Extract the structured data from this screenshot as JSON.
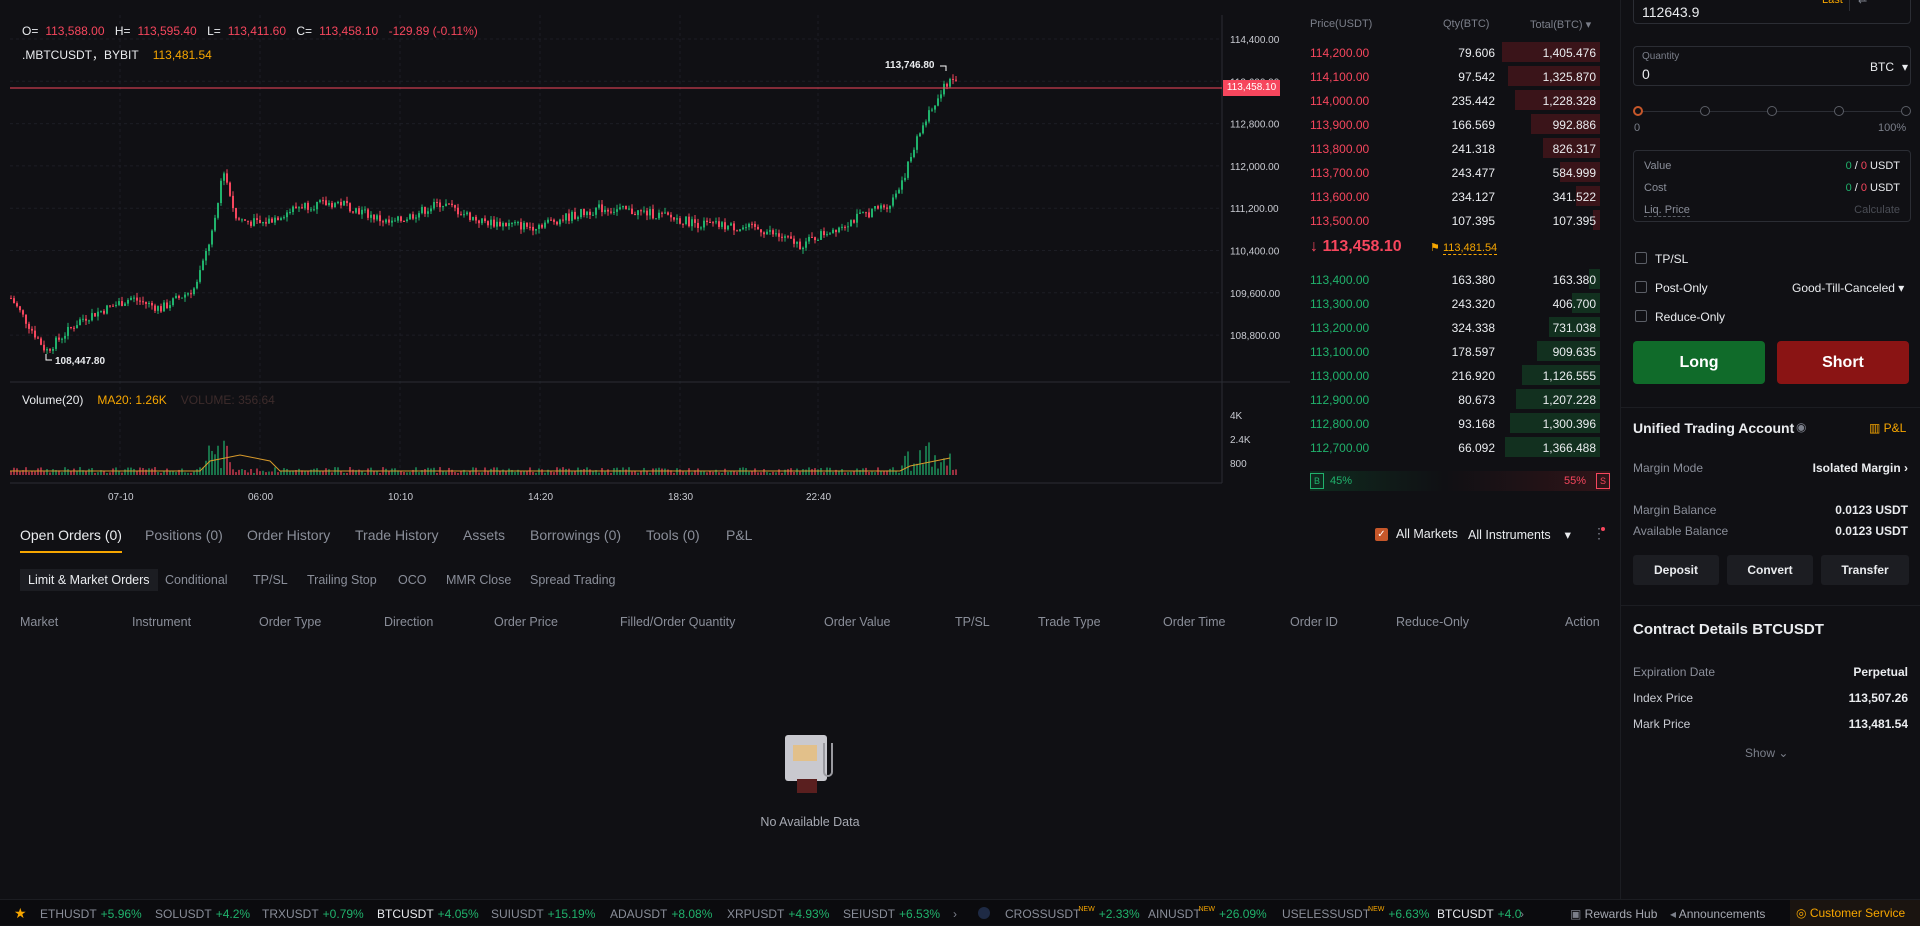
{
  "chart": {
    "ohlc": {
      "o_label": "O=",
      "o": "113,588.00",
      "h_label": "H=",
      "h": "113,595.40",
      "l_label": "L=",
      "l": "113,411.60",
      "c_label": "C=",
      "c": "113,458.10",
      "chg": "-129.89 (-0.11%)"
    },
    "symbol": ".MBTCUSDT，BYBIT",
    "symbol_price": "113,481.54",
    "high_marker": "113,746.80",
    "low_marker": "108,447.80",
    "last_price_tag": "113,458.10",
    "y_ticks": [
      "114,400.00",
      "113,600.00",
      "112,800.00",
      "112,000.00",
      "111,200.00",
      "110,400.00",
      "109,600.00",
      "108,800.00"
    ],
    "vol_ticks": [
      "4K",
      "2.4K",
      "800"
    ],
    "x_ticks": [
      "07-10",
      "06:00",
      "10:10",
      "14:20",
      "18:30",
      "22:40"
    ],
    "volume_label": "Volume(20)",
    "ma_label": "MA20: 1.26K",
    "volume_val": "VOLUME: 356.64"
  },
  "orderbook": {
    "headers": {
      "price": "Price(USDT)",
      "qty": "Qty(BTC)",
      "total": "Total(BTC)"
    },
    "asks": [
      {
        "p": "114,200.00",
        "q": "79.606",
        "t": "1,405.476",
        "d": 0.98
      },
      {
        "p": "114,100.00",
        "q": "97.542",
        "t": "1,325.870",
        "d": 0.92
      },
      {
        "p": "114,000.00",
        "q": "235.442",
        "t": "1,228.328",
        "d": 0.85
      },
      {
        "p": "113,900.00",
        "q": "166.569",
        "t": "992.886",
        "d": 0.69
      },
      {
        "p": "113,800.00",
        "q": "241.318",
        "t": "826.317",
        "d": 0.57
      },
      {
        "p": "113,700.00",
        "q": "243.477",
        "t": "584.999",
        "d": 0.4
      },
      {
        "p": "113,600.00",
        "q": "234.127",
        "t": "341.522",
        "d": 0.24
      },
      {
        "p": "113,500.00",
        "q": "107.395",
        "t": "107.395",
        "d": 0.07
      }
    ],
    "mid_price": "113,458.10",
    "mark_price": "113,481.54",
    "bids": [
      {
        "p": "113,400.00",
        "q": "163.380",
        "t": "163.380",
        "d": 0.11
      },
      {
        "p": "113,300.00",
        "q": "243.320",
        "t": "406.700",
        "d": 0.28
      },
      {
        "p": "113,200.00",
        "q": "324.338",
        "t": "731.038",
        "d": 0.51
      },
      {
        "p": "113,100.00",
        "q": "178.597",
        "t": "909.635",
        "d": 0.63
      },
      {
        "p": "113,000.00",
        "q": "216.920",
        "t": "1,126.555",
        "d": 0.78
      },
      {
        "p": "112,900.00",
        "q": "80.673",
        "t": "1,207.228",
        "d": 0.84
      },
      {
        "p": "112,800.00",
        "q": "93.168",
        "t": "1,300.396",
        "d": 0.9
      },
      {
        "p": "112,700.00",
        "q": "66.092",
        "t": "1,366.488",
        "d": 0.95
      }
    ],
    "buy_label": "B",
    "buy_pct": "45%",
    "sell_pct": "55%",
    "sell_label": "S"
  },
  "bottom": {
    "tabs": [
      "Open Orders (0)",
      "Positions (0)",
      "Order History",
      "Trade History",
      "Assets",
      "Borrowings (0)",
      "Tools (0)",
      "P&L"
    ],
    "all_markets": "All Markets",
    "all_instruments": "All Instruments",
    "subtabs": [
      "Limit & Market Orders",
      "Conditional",
      "TP/SL",
      "Trailing Stop",
      "OCO",
      "MMR Close",
      "Spread Trading"
    ],
    "columns": [
      "Market",
      "Instrument",
      "Order Type",
      "Direction",
      "Order Price",
      "Filled/Order Quantity",
      "Order Value",
      "TP/SL",
      "Trade Type",
      "Order Time",
      "Order ID",
      "Reduce-Only",
      "Action"
    ],
    "empty": "No Available Data"
  },
  "panel": {
    "price_value": "112643.9",
    "price_type": "Last",
    "qty_label": "Quantity",
    "qty_value": "0",
    "qty_unit": "BTC",
    "slider_min": "0",
    "slider_max": "100%",
    "value_label": "Value",
    "value_val": "0",
    "value_sep": " / ",
    "value_val2": "0",
    "value_unit": " USDT",
    "cost_label": "Cost",
    "cost_val": "0",
    "cost_val2": "0",
    "cost_unit": " USDT",
    "liq_label": "Liq. Price",
    "liq_val": "Calculate",
    "tpsl": "TP/SL",
    "post_only": "Post-Only",
    "tif": "Good-Till-Canceled",
    "reduce_only": "Reduce-Only",
    "long": "Long",
    "short": "Short",
    "uta_title": "Unified Trading Account",
    "pnl": "P&L",
    "margin_mode_label": "Margin Mode",
    "margin_mode": "Isolated Margin",
    "margin_balance_label": "Margin Balance",
    "margin_balance": "0.0123 USDT",
    "avail_balance_label": "Available Balance",
    "avail_balance": "0.0123 USDT",
    "deposit": "Deposit",
    "convert": "Convert",
    "transfer": "Transfer",
    "contract_title": "Contract Details BTCUSDT",
    "exp_label": "Expiration Date",
    "exp_val": "Perpetual",
    "index_label": "Index Price",
    "index_val": "113,507.26",
    "mark_label": "Mark Price",
    "mark_val": "113,481.54",
    "show": "Show"
  },
  "ticker": {
    "items": [
      {
        "s": "ETHUSDT",
        "c": "+5.96%"
      },
      {
        "s": "SOLUSDT",
        "c": "+4.2%"
      },
      {
        "s": "TRXUSDT",
        "c": "+0.79%"
      },
      {
        "s": "BTCUSDT",
        "c": "+4.05%"
      },
      {
        "s": "SUIUSDT",
        "c": "+15.19%"
      },
      {
        "s": "ADAUSDT",
        "c": "+8.08%"
      },
      {
        "s": "XRPUSDT",
        "c": "+4.93%"
      },
      {
        "s": "SEIUSDT",
        "c": "+6.53%"
      }
    ],
    "items2": [
      {
        "s": "CROSSUSDT",
        "c": "+2.33%",
        "n": "NEW"
      },
      {
        "s": "AINUSDT",
        "c": "+26.09%",
        "n": "NEW"
      },
      {
        "s": "USELESSUSDT",
        "c": "+6.63%",
        "n": "NEW"
      },
      {
        "s": "BTCUSDT",
        "c": "+4.0"
      }
    ],
    "rewards": "Rewards Hub",
    "announcements": "Announcements",
    "support": "Customer Service"
  },
  "colors": {
    "up": "#20b26c",
    "down": "#f6465d",
    "accent": "#f7a600",
    "bg": "#101014"
  }
}
